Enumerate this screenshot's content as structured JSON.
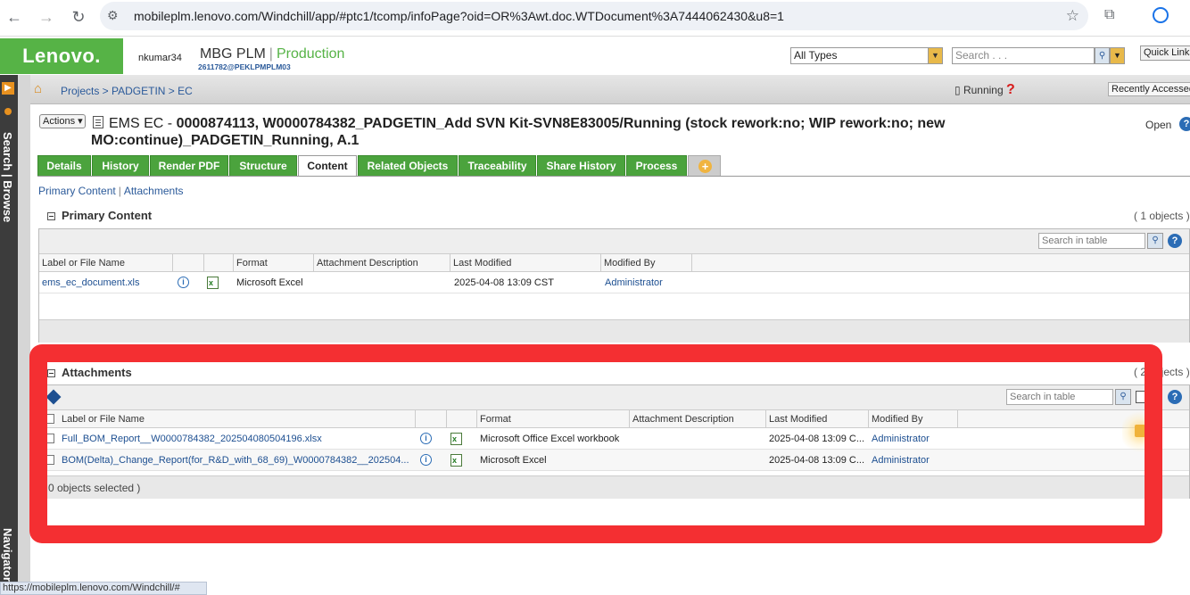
{
  "browser": {
    "url": "mobileplm.lenovo.com/Windchill/app/#ptc1/tcomp/infoPage?oid=OR%3Awt.doc.WTDocument%3A7444062430&u8=1",
    "status_url": "https://mobileplm.lenovo.com/Windchill/#"
  },
  "header": {
    "logo": "Lenovo.",
    "user": "nkumar34",
    "app_name": "MBG PLM",
    "separator": "|",
    "environment": "Production",
    "user_id": "2611782@PEKLPMPLM03",
    "type_select": "All Types",
    "search_placeholder": "Search . . .",
    "quick_links": "Quick Links"
  },
  "left_bar": {
    "search_browse": "Search | Browse",
    "navigator": "Navigator"
  },
  "crumbs": {
    "path": "Projects > PADGETIN > EC",
    "status": "Running",
    "help_mark": "?",
    "recently_accessed": "Recently Accessed"
  },
  "document": {
    "actions_label": "Actions ▾",
    "type_prefix": "EMS EC - ",
    "title": "0000874113, W0000784382_PADGETIN_Add SVN Kit-SVN8E83005/Running (stock rework:no; WIP rework:no; new MO:continue)_PADGETIN_Running, A.1",
    "open_label": "Open",
    "help_mark": "?"
  },
  "tabs": [
    {
      "label": "Details"
    },
    {
      "label": "History"
    },
    {
      "label": "Render PDF"
    },
    {
      "label": "Structure"
    },
    {
      "label": "Content"
    },
    {
      "label": "Related Objects"
    },
    {
      "label": "Traceability"
    },
    {
      "label": "Share History"
    },
    {
      "label": "Process"
    }
  ],
  "subnav": {
    "primary": "Primary Content",
    "pipe": "|",
    "attachments": "Attachments"
  },
  "primary_content": {
    "title": "Primary Content",
    "count": "( 1 objects )",
    "search_placeholder": "Search in table",
    "help_mark": "?",
    "columns": [
      "Label or File Name",
      "",
      "",
      "Format",
      "Attachment Description",
      "Last Modified",
      "Modified By"
    ],
    "rows": [
      {
        "name": "ems_ec_document.xls",
        "info": "i",
        "format": "Microsoft Excel",
        "description": "",
        "modified": "2025-04-08 13:09 CST",
        "modified_by": "Administrator"
      }
    ]
  },
  "attachments": {
    "title": "Attachments",
    "count": "( 2 objects )",
    "search_placeholder": "Search in table",
    "help_mark": "?",
    "columns": [
      "Label or File Name",
      "",
      "",
      "Format",
      "Attachment Description",
      "Last Modified",
      "Modified By"
    ],
    "rows": [
      {
        "name": "Full_BOM_Report__W0000784382_202504080504196.xlsx",
        "info": "i",
        "format": "Microsoft Office Excel workbook",
        "description": "",
        "modified": "2025-04-08 13:09 C...",
        "modified_by": "Administrator"
      },
      {
        "name": "BOM(Delta)_Change_Report(for_R&D_with_68_69)_W0000784382__202504...",
        "info": "i",
        "format": "Microsoft Excel",
        "description": "",
        "modified": "2025-04-08 13:09 C...",
        "modified_by": "Administrator"
      }
    ],
    "selected_text": "0 objects selected )"
  },
  "colors": {
    "lenovo_green": "#56b346",
    "tab_green": "#4ba33d",
    "link_blue": "#1d4f91",
    "highlight_red": "#f42f32"
  }
}
